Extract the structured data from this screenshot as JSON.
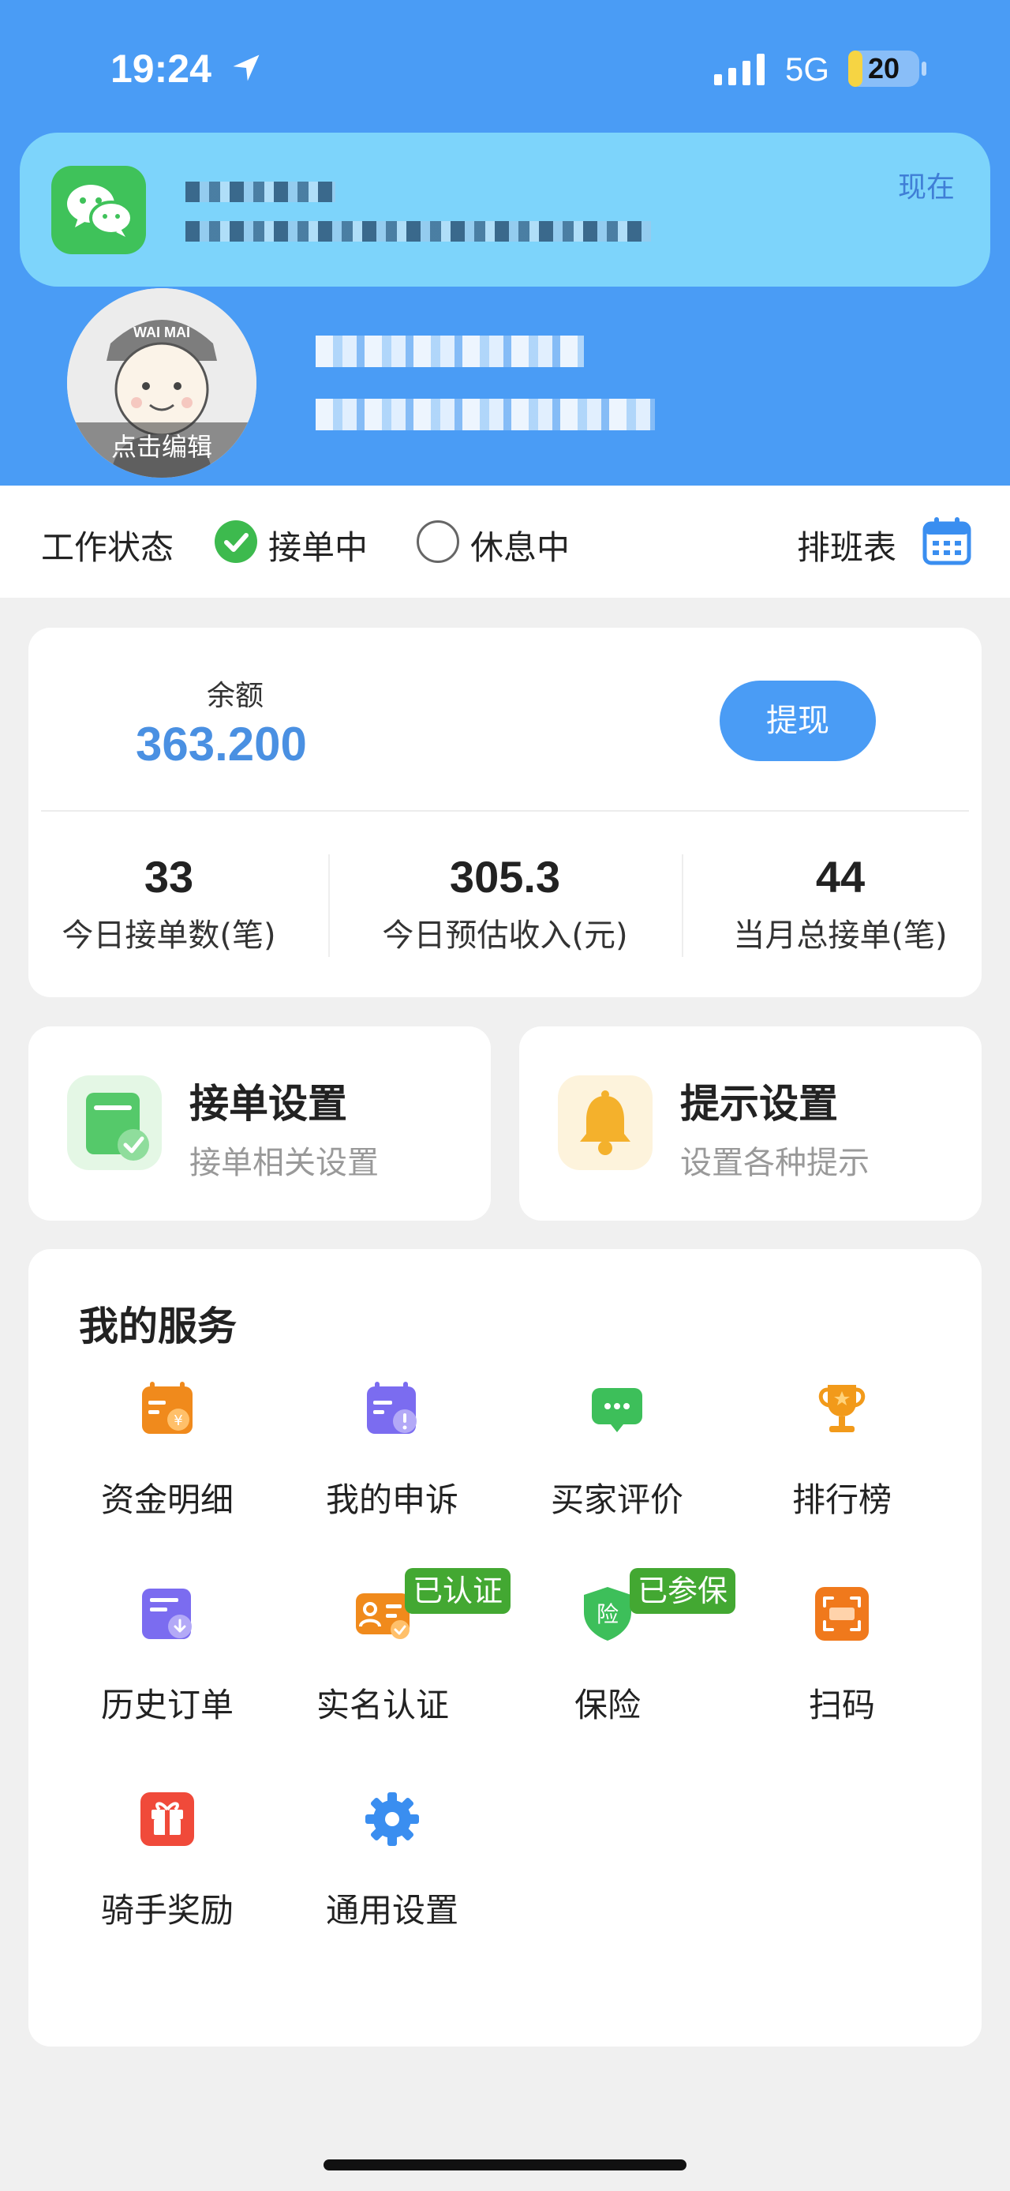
{
  "status_bar": {
    "time": "19:24",
    "network": "5G",
    "battery": "20",
    "battery_level": 0.2
  },
  "notification": {
    "time": "现在"
  },
  "profile": {
    "avatar_edit": "点击编辑",
    "avatar_cap_text": "WAI MAI"
  },
  "work_status": {
    "label": "工作状态",
    "options": [
      "接单中",
      "休息中"
    ],
    "selected": "接单中",
    "schedule_label": "排班表"
  },
  "balance": {
    "label": "余额",
    "value": "363.200",
    "withdraw_label": "提现"
  },
  "stats": [
    {
      "value": "33",
      "label": "今日接单数(笔)"
    },
    {
      "value": "305.3",
      "label": "今日预估收入(元)"
    },
    {
      "value": "44",
      "label": "当月总接单(笔)"
    }
  ],
  "settings": [
    {
      "title": "接单设置",
      "subtitle": "接单相关设置"
    },
    {
      "title": "提示设置",
      "subtitle": "设置各种提示"
    }
  ],
  "services": {
    "title": "我的服务",
    "items": [
      {
        "label": "资金明细",
        "icon": "wallet-calendar-icon"
      },
      {
        "label": "我的申诉",
        "icon": "appeal-icon"
      },
      {
        "label": "买家评价",
        "icon": "comment-icon"
      },
      {
        "label": "排行榜",
        "icon": "trophy-icon"
      },
      {
        "label": "历史订单",
        "icon": "history-order-icon"
      },
      {
        "label": "实名认证",
        "icon": "id-card-icon",
        "badge": "已认证"
      },
      {
        "label": "保险",
        "icon": "insurance-shield-icon",
        "badge": "已参保",
        "icon_text": "险"
      },
      {
        "label": "扫码",
        "icon": "scan-icon"
      },
      {
        "label": "骑手奖励",
        "icon": "gift-icon"
      },
      {
        "label": "通用设置",
        "icon": "gear-icon"
      }
    ]
  },
  "colors": {
    "header": "#4a9cf5",
    "accent": "#4a90e2",
    "success": "#3dba4e",
    "badge": "#43a832"
  }
}
